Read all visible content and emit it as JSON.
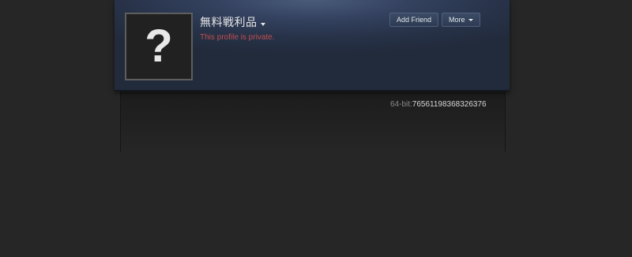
{
  "profile": {
    "persona_name": "無料戦利品",
    "private_notice": "This profile is private.",
    "avatar_placeholder": "?",
    "avatar_icon": "question-mark-icon"
  },
  "actions": {
    "add_friend_label": "Add Friend",
    "more_label": "More"
  },
  "steam_id": {
    "label": "64-bit:",
    "value": "76561198368326376"
  },
  "colors": {
    "background": "#262626",
    "header": "#2a3550",
    "private_text": "#c04f4f"
  }
}
